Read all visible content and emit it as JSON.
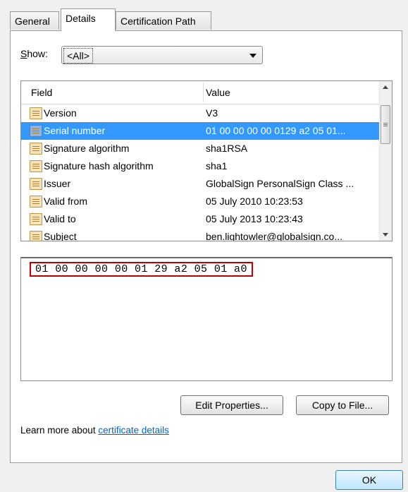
{
  "tabs": [
    {
      "label": "General",
      "active": false
    },
    {
      "label": "Details",
      "active": true
    },
    {
      "label": "Certification Path",
      "active": false
    }
  ],
  "show": {
    "label_prefix": "S",
    "label_rest": "how:",
    "selected": "<All>"
  },
  "list": {
    "columns": [
      "Field",
      "Value"
    ],
    "rows": [
      {
        "field": "Version",
        "value": "V3",
        "selected": false
      },
      {
        "field": "Serial number",
        "value": "01 00 00 00 00 0129 a2 05 01...",
        "selected": true
      },
      {
        "field": "Signature algorithm",
        "value": "sha1RSA",
        "selected": false
      },
      {
        "field": "Signature hash algorithm",
        "value": "sha1",
        "selected": false
      },
      {
        "field": "Issuer",
        "value": "GlobalSign PersonalSign Class ...",
        "selected": false
      },
      {
        "field": "Valid from",
        "value": "05 July 2010 10:23:53",
        "selected": false
      },
      {
        "field": "Valid to",
        "value": "05 July 2013 10:23:43",
        "selected": false
      },
      {
        "field": "Subject",
        "value": "ben.lightowler@globalsign.co...",
        "selected": false
      }
    ]
  },
  "detail_value": "01 00 00 00 00 01 29 a2 05 01 a0",
  "buttons": {
    "edit": "Edit Properties...",
    "copy": "Copy to File...",
    "ok": "OK"
  },
  "learn_more": {
    "text": "Learn more about ",
    "link": "certificate details"
  },
  "colors": {
    "selection": "#3399ff",
    "highlight_box": "#c00000",
    "link": "#0066cc"
  }
}
